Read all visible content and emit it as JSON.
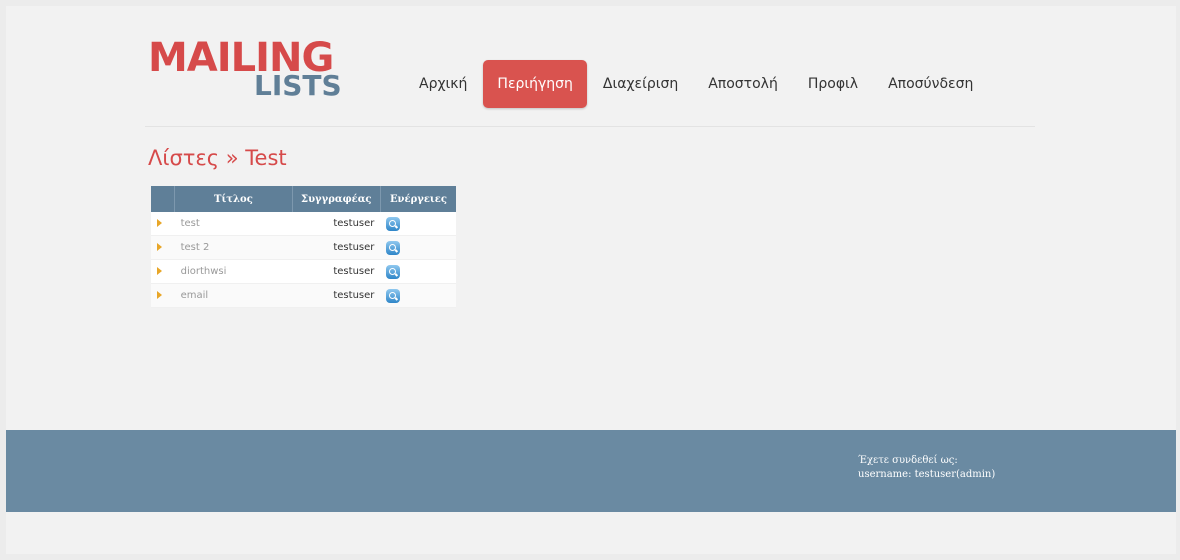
{
  "logo": {
    "line1": "MAILING",
    "line2": "LISTS"
  },
  "nav": {
    "items": [
      {
        "label": "Αρχική"
      },
      {
        "label": "Περιήγηση",
        "active": true
      },
      {
        "label": "Διαχείριση"
      },
      {
        "label": "Αποστολή"
      },
      {
        "label": "Προφιλ"
      },
      {
        "label": "Αποσύνδεση"
      }
    ]
  },
  "breadcrumb": "Λίστες » Test",
  "table": {
    "headers": [
      "Τίτλος",
      "Συγγραφέας",
      "Ενέργειες"
    ],
    "rows": [
      {
        "title": "test",
        "author": "testuser"
      },
      {
        "title": "test 2",
        "author": "testuser"
      },
      {
        "title": "diorthwsi",
        "author": "testuser"
      },
      {
        "title": "email",
        "author": "testuser"
      }
    ],
    "action_icon": "view-icon"
  },
  "footer": {
    "line1": "Έχετε συνδεθεί ως:",
    "line2": "username: testuser(admin)"
  },
  "colors": {
    "brand_red": "#d64a4a",
    "brand_blue": "#607f97",
    "footer_bg": "#6a8aa2"
  }
}
